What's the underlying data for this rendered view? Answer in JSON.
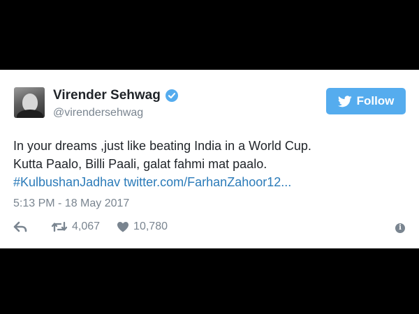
{
  "tweet": {
    "author": {
      "display_name": "Virender Sehwag",
      "handle": "@virendersehwag",
      "verified": true
    },
    "follow_button": {
      "label": "Follow",
      "icon": "twitter-bird-icon",
      "color": "#55acee"
    },
    "text": {
      "line1": "In your dreams ,just like beating India in a World Cup.",
      "line2": "Kutta Paalo, Billi Paali, galat fahmi mat paalo.",
      "hashtag": "#KulbushanJadhav",
      "url": "twitter.com/FarhanZahoor12..."
    },
    "timestamp": "5:13 PM - 18 May 2017",
    "actions": {
      "reply_icon": "reply-icon",
      "retweet_icon": "retweet-icon",
      "retweet_count": "4,067",
      "like_icon": "heart-icon",
      "like_count": "10,780",
      "info_icon": "info-icon"
    },
    "colors": {
      "link": "#2b7bb9",
      "muted": "#7a8590",
      "text": "#1f2328"
    }
  }
}
